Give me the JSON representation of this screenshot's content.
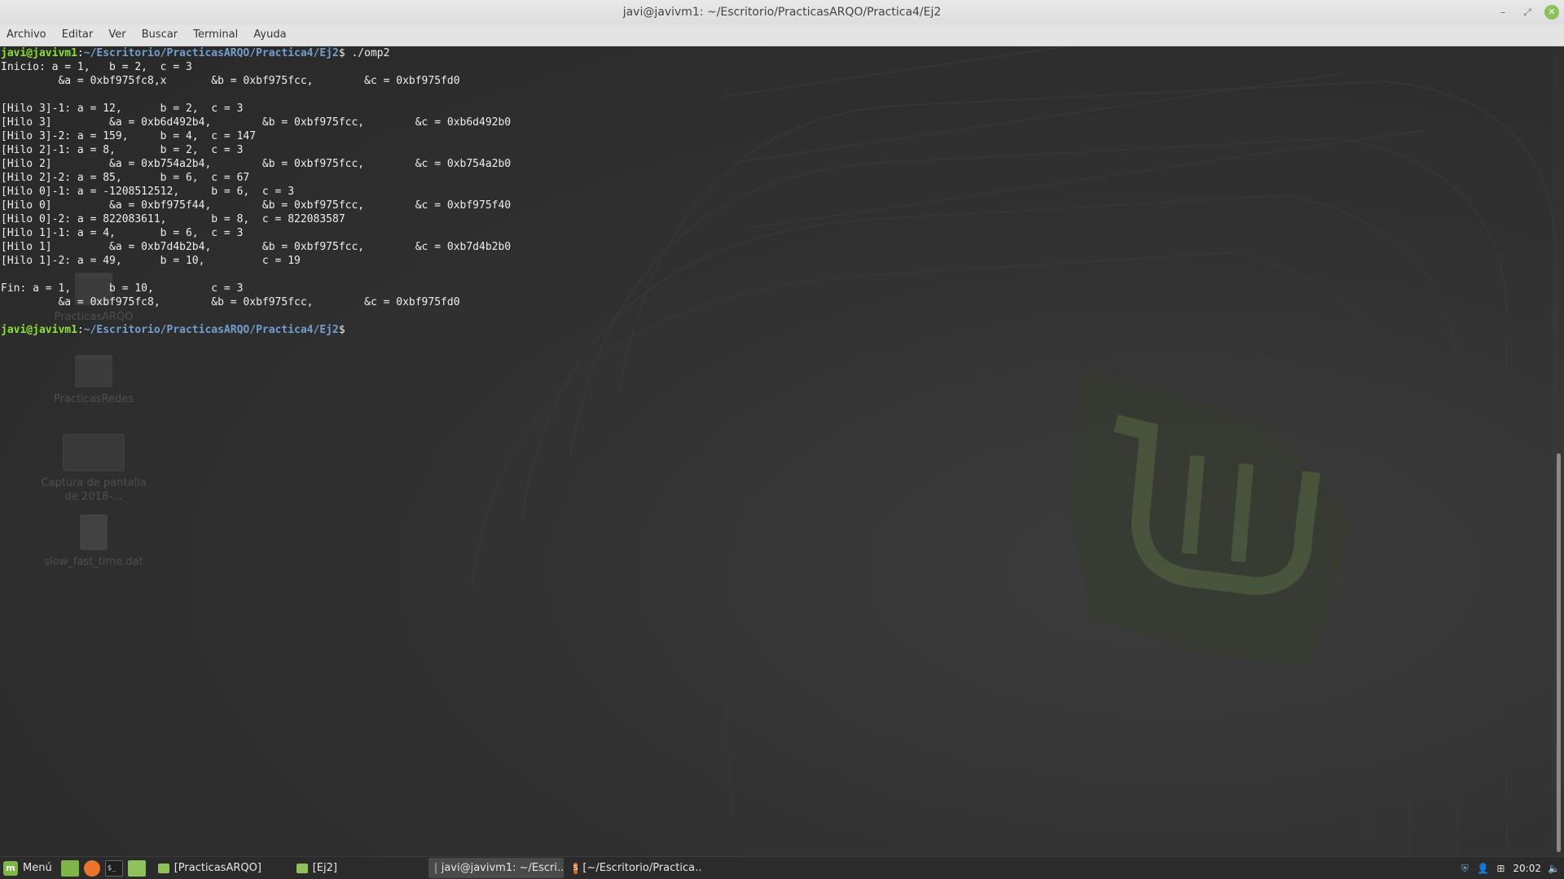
{
  "window": {
    "title": "javi@javivm1: ~/Escritorio/PracticasARQO/Practica4/Ej2",
    "controls": {
      "minimize": "–",
      "maximize": "⤢",
      "close": "✕"
    }
  },
  "menubar": [
    "Archivo",
    "Editar",
    "Ver",
    "Buscar",
    "Terminal",
    "Ayuda"
  ],
  "terminal": {
    "prompt_user": "javi@javivm1",
    "prompt_path": "~/Escritorio/PracticasARQO/Practica4/Ej2",
    "command": " ./omp2",
    "lines": [
      "Inicio: a = 1,   b = 2,  c = 3",
      "         &a = 0xbf975fc8,x       &b = 0xbf975fcc,        &c = 0xbf975fd0",
      "",
      "[Hilo 3]-1: a = 12,      b = 2,  c = 3",
      "[Hilo 3]         &a = 0xb6d492b4,        &b = 0xbf975fcc,        &c = 0xb6d492b0",
      "[Hilo 3]-2: a = 159,     b = 4,  c = 147",
      "[Hilo 2]-1: a = 8,       b = 2,  c = 3",
      "[Hilo 2]         &a = 0xb754a2b4,        &b = 0xbf975fcc,        &c = 0xb754a2b0",
      "[Hilo 2]-2: a = 85,      b = 6,  c = 67",
      "[Hilo 0]-1: a = -1208512512,     b = 6,  c = 3",
      "[Hilo 0]         &a = 0xbf975f44,        &b = 0xbf975fcc,        &c = 0xbf975f40",
      "[Hilo 0]-2: a = 822083611,       b = 8,  c = 822083587",
      "[Hilo 1]-1: a = 4,       b = 6,  c = 3",
      "[Hilo 1]         &a = 0xb7d4b2b4,        &b = 0xbf975fcc,        &c = 0xb7d4b2b0",
      "[Hilo 1]-2: a = 49,      b = 10,         c = 19",
      "",
      "Fin: a = 1,      b = 10,         c = 3",
      "         &a = 0xbf975fc8,        &b = 0xbf975fcc,        &c = 0xbf975fd0",
      ""
    ]
  },
  "desktop_icons": [
    {
      "label": "PracticasARQO",
      "icon": "folder-icon"
    },
    {
      "label": "PracticasRedes",
      "icon": "folder-icon"
    },
    {
      "label": "Captura de pantalla de 2018-...",
      "icon": "image-file-icon"
    },
    {
      "label": "slow_fast_time.dat",
      "icon": "text-file-icon"
    }
  ],
  "taskbar": {
    "menu_label": "Menú",
    "launchers": [
      "show-desktop-icon",
      "firefox-icon",
      "terminal-icon",
      "files-icon"
    ],
    "tasks": [
      {
        "label": "[PracticasARQO]",
        "icon": "folder-icon",
        "active": false
      },
      {
        "label": "[Ej2]",
        "icon": "folder-icon",
        "active": false
      },
      {
        "label": "javi@javivm1: ~/Escri...",
        "icon": "terminal-icon",
        "active": true
      },
      {
        "label": "[~/Escritorio/Practica...",
        "icon": "sublime-icon",
        "active": false
      }
    ],
    "clock": "20:02"
  },
  "colors": {
    "prompt_user": "#8ae234",
    "prompt_path": "#729fcf",
    "mint_accent": "#7fb64a"
  }
}
